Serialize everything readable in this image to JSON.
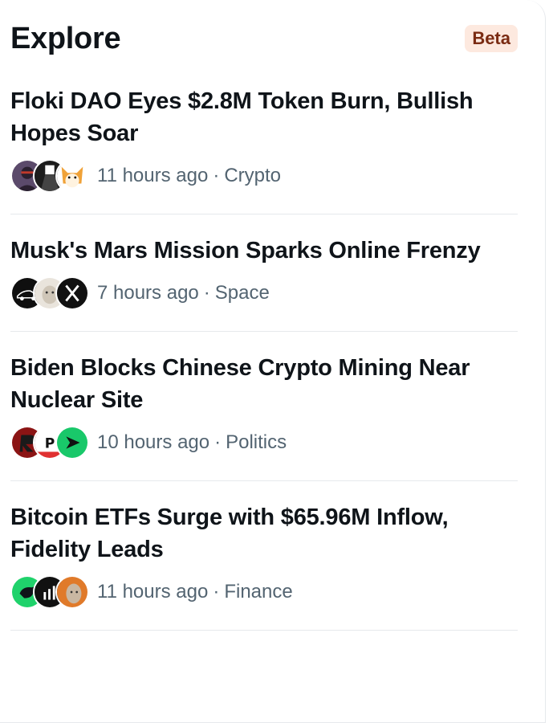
{
  "header": {
    "title": "Explore",
    "badge": "Beta"
  },
  "items": [
    {
      "headline": "Floki DAO Eyes $2.8M Token Burn, Bullish Hopes Soar",
      "time": "11 hours ago",
      "category": "Crypto",
      "avatars": [
        {
          "icon": "person-avatar-icon",
          "bg": "#5b4a6b",
          "fg": "#c0392b"
        },
        {
          "icon": "dark-figure-avatar-icon",
          "bg": "#1d1d1d",
          "fg": "#ffffff"
        },
        {
          "icon": "shiba-dog-avatar-icon",
          "bg": "#f0a238",
          "fg": "#ffffff"
        }
      ]
    },
    {
      "headline": "Musk's Mars Mission Sparks Online Frenzy",
      "time": "7 hours ago",
      "category": "Space",
      "avatars": [
        {
          "icon": "car-avatar-icon",
          "bg": "#0f0f0f",
          "fg": "#ffffff"
        },
        {
          "icon": "dog-avatar-icon",
          "bg": "#e9e4dc",
          "fg": "#7a6a55"
        },
        {
          "icon": "x-logo-avatar-icon",
          "bg": "#111111",
          "fg": "#ffffff"
        }
      ]
    },
    {
      "headline": "Biden Blocks Chinese Crypto Mining Near Nuclear Site",
      "time": "10 hours ago",
      "category": "Politics",
      "avatars": [
        {
          "icon": "r-logo-avatar-icon",
          "bg": "#8b1414",
          "fg": "#1a1a1a"
        },
        {
          "icon": "p-logo-avatar-icon",
          "bg": "#ffffff",
          "fg": "#111111"
        },
        {
          "icon": "green-arrow-avatar-icon",
          "bg": "#19c86a",
          "fg": "#111111"
        }
      ]
    },
    {
      "headline": "Bitcoin ETFs Surge with $65.96M Inflow, Fidelity Leads",
      "time": "11 hours ago",
      "category": "Finance",
      "avatars": [
        {
          "icon": "green-bird-avatar-icon",
          "bg": "#1fd26b",
          "fg": "#0f1419"
        },
        {
          "icon": "signal-bars-avatar-icon",
          "bg": "#111111",
          "fg": "#ffffff"
        },
        {
          "icon": "face-avatar-icon",
          "bg": "#e07a2a",
          "fg": "#5a4a3a"
        }
      ]
    }
  ]
}
